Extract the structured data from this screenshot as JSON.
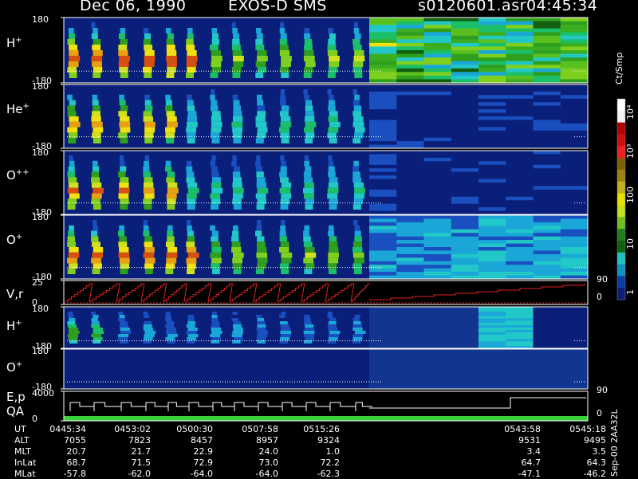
{
  "header": {
    "date": "Dec 06, 1990",
    "mission": "EXOS-D SMS",
    "file": "s0120601.asr",
    "time": "04:45:34"
  },
  "panels": [
    {
      "id": "h_plus_1",
      "label": "H",
      "charge": "+",
      "top_tick": "180",
      "bottom_tick": "-180",
      "style": "spectro",
      "intensity": "high"
    },
    {
      "id": "he_plus",
      "label": "He",
      "charge": "+",
      "top_tick": "180",
      "bottom_tick": "-180",
      "style": "spectro",
      "intensity": "medium"
    },
    {
      "id": "o_plusplus",
      "label": "O",
      "charge": "++",
      "top_tick": "180",
      "bottom_tick": "-180",
      "style": "spectro",
      "intensity": "medium"
    },
    {
      "id": "o_plus_1",
      "label": "O",
      "charge": "+",
      "top_tick": "180",
      "bottom_tick": "-180",
      "style": "spectro",
      "intensity": "high"
    },
    {
      "id": "vr",
      "label": "V,r",
      "charge": "",
      "top_tick": "25",
      "bottom_tick": "0",
      "right_top_tick": "90",
      "right_bottom_tick": "0",
      "style": "line"
    },
    {
      "id": "h_plus_2",
      "label": "H",
      "charge": "+",
      "top_tick": "180",
      "bottom_tick": "-180",
      "style": "spectro",
      "intensity": "low"
    },
    {
      "id": "o_plus_2",
      "label": "O",
      "charge": "+",
      "top_tick": "180",
      "bottom_tick": "-180",
      "style": "spectro",
      "intensity": "verylow"
    },
    {
      "id": "ep_qa",
      "label": "E,p",
      "label2": "QA",
      "charge": "",
      "top_tick": "4000",
      "bottom_tick": "0",
      "right_top_tick": "90",
      "right_bottom_tick": "0",
      "style": "step"
    }
  ],
  "colorbar": {
    "unit_label": "Ct/Smp",
    "tick_labels": [
      "10⁴",
      "10³",
      "100",
      "10",
      "1"
    ]
  },
  "footer": {
    "row_labels": [
      "UT",
      "ALT",
      "MLT",
      "InLat",
      "MLat"
    ],
    "columns": [
      {
        "values": [
          "0445:34",
          "7055",
          "20.7",
          "68.7",
          "-57.8"
        ]
      },
      {
        "values": [
          "0453:02",
          "7823",
          "21.7",
          "71.5",
          "-62.0"
        ]
      },
      {
        "values": [
          "0500:30",
          "8457",
          "22.9",
          "72.9",
          "-64.0"
        ]
      },
      {
        "values": [
          "0507:58",
          "8957",
          "24.0",
          "73.0",
          "-64.0"
        ]
      },
      {
        "values": [
          "0515:26",
          "9324",
          "1.0",
          "72.2",
          "-62.3"
        ]
      },
      {
        "values": [
          "0543:58",
          "9531",
          "3.4",
          "64.7",
          "-47.1"
        ]
      },
      {
        "values": [
          "0545:18",
          "9495",
          "3.5",
          "64.3",
          "-46.2"
        ]
      }
    ],
    "side_note": "Sep-00  2AA32L"
  },
  "chart_data": {
    "type": "heatmap",
    "title": "Dec 06, 1990   EXOS-D SMS",
    "subtitle": "s0120601.asr  04:45:34",
    "x": [
      "0445:34",
      "0453:02",
      "0500:30",
      "0507:58",
      "0515:26",
      "0543:58",
      "0545:18"
    ],
    "panel_series": [
      {
        "name": "H+",
        "ylim": [
          -180,
          180
        ]
      },
      {
        "name": "He+",
        "ylim": [
          -180,
          180
        ]
      },
      {
        "name": "O++",
        "ylim": [
          -180,
          180
        ]
      },
      {
        "name": "O+",
        "ylim": [
          -180,
          180
        ]
      },
      {
        "name": "V,r",
        "ylim": [
          0,
          25
        ],
        "y2lim": [
          0,
          90
        ]
      },
      {
        "name": "H+",
        "ylim": [
          -180,
          180
        ]
      },
      {
        "name": "O+",
        "ylim": [
          -180,
          180
        ]
      },
      {
        "name": "E,p / QA",
        "ylim": [
          0,
          4000
        ],
        "y2lim": [
          0,
          90
        ]
      }
    ],
    "colorbar_scale": "log",
    "colorbar_range": [
      1,
      10000
    ],
    "colorbar_label": "Ct/Smp"
  }
}
